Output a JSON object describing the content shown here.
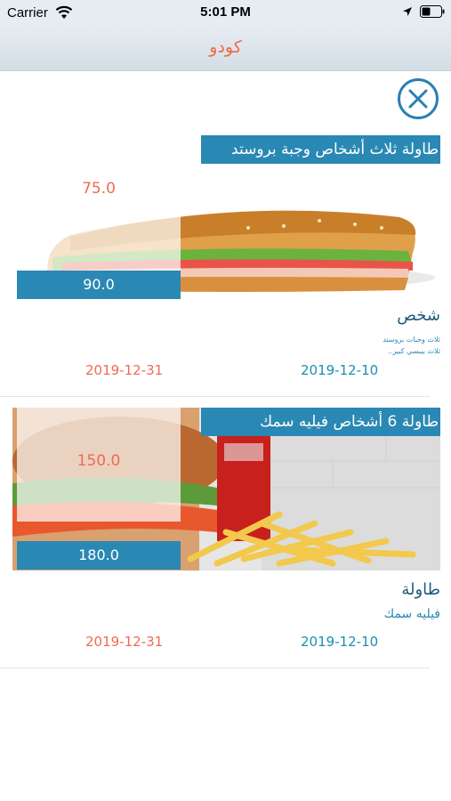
{
  "status_bar": {
    "carrier": "Carrier",
    "time": "5:01 PM"
  },
  "header": {
    "title": "كودو",
    "title_color": "#ef6a45"
  },
  "offers": [
    {
      "title": "طاولة ثلاث أشخاص وجبة بروستد",
      "new_price": "75.0",
      "old_price": "90.0",
      "name": "شخص",
      "description_lines": [
        "ثلاث وجبات بروستد",
        "ثلاث بيبسي كبير.."
      ],
      "start_date": "2019-12-10",
      "end_date": "2019-12-31",
      "image_icon": "sandwich-image"
    },
    {
      "title": "طاولة 6 أشخاص فيليه سمك",
      "new_price": "150.0",
      "old_price": "180.0",
      "name": "طاولة",
      "description": "فيليه سمك",
      "start_date": "2019-12-10",
      "end_date": "2019-12-31",
      "image_icon": "burger-fries-image"
    }
  ],
  "colors": {
    "accent_blue": "#2a88b4",
    "price_red": "#f06a52",
    "date_blue": "#1a8fb0"
  }
}
